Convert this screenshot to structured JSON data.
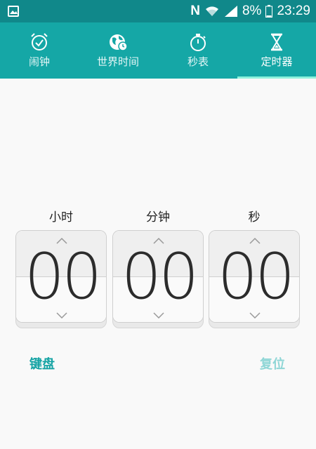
{
  "status_bar": {
    "battery": "8%",
    "time": "23:29",
    "nfc_label": "N",
    "icons": [
      "gallery-icon",
      "nfc-icon",
      "wifi-icon",
      "signal-icon",
      "battery-icon"
    ]
  },
  "tabs": [
    {
      "label": "闹钟",
      "icon": "alarm-icon",
      "active": false
    },
    {
      "label": "世界时间",
      "icon": "world-clock-icon",
      "active": false
    },
    {
      "label": "秒表",
      "icon": "stopwatch-icon",
      "active": false
    },
    {
      "label": "定时器",
      "icon": "hourglass-icon",
      "active": true
    }
  ],
  "timer": {
    "hours_label": "小时",
    "minutes_label": "分钟",
    "seconds_label": "秒",
    "hours": "00",
    "minutes": "00",
    "seconds": "00"
  },
  "actions": {
    "keyboard": "键盘",
    "reset": "复位"
  },
  "colors": {
    "status_bar": "#10888a",
    "tab_bar": "#15a7a6",
    "tab_indicator": "#8df2dc",
    "accent_text": "#15a3a4",
    "disabled_text": "#8fd6d6"
  }
}
